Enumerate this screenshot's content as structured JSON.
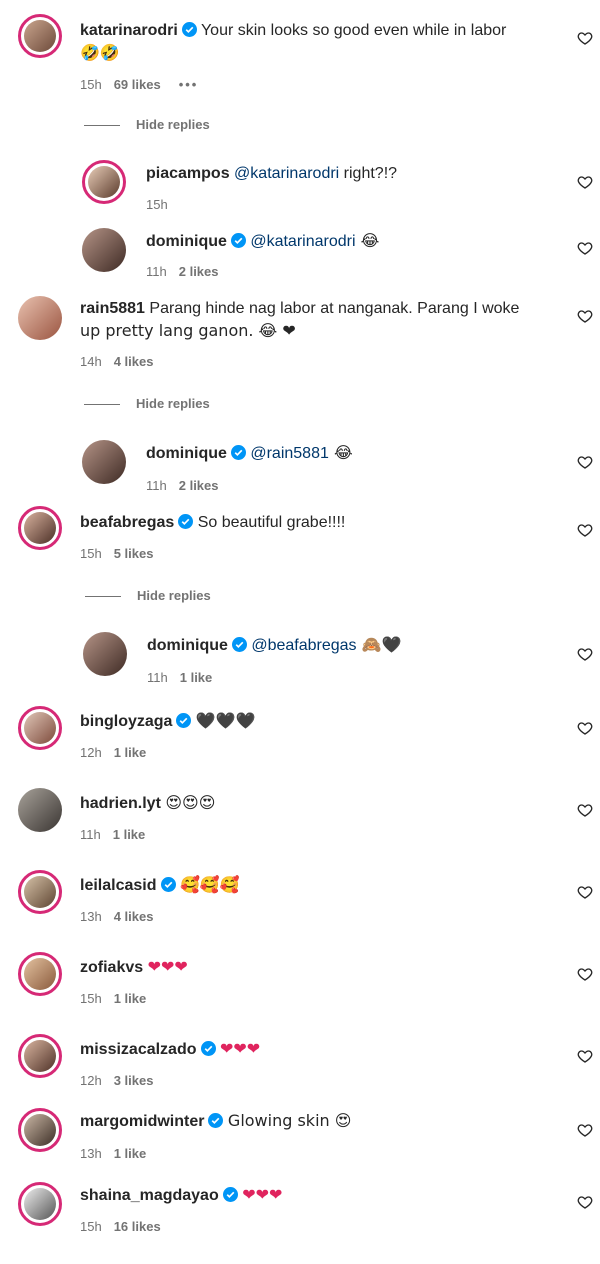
{
  "comments": [
    {
      "username": "katarinarodri",
      "verified": true,
      "text": "Your skin looks so good even while in labor",
      "text2": "🤣🤣",
      "time": "15h",
      "likes": "69 likes",
      "more": "•••"
    },
    {
      "username": "piacampos",
      "verified": false,
      "mention": "@katarinarodri",
      "text": " right?!?",
      "time": "15h",
      "likes": ""
    },
    {
      "username": "dominique",
      "verified": true,
      "mention": "@katarinarodri",
      "text": " 😂",
      "time": "11h",
      "likes": "2 likes"
    },
    {
      "username": "rain5881",
      "verified": false,
      "text": "Parang hinde nag labor at nanganak. Parang I woke",
      "text2": "up pretty lang ganon. 😂 ❤",
      "time": "14h",
      "likes": "4 likes"
    },
    {
      "username": "dominique",
      "verified": true,
      "mention": "@rain5881",
      "text": " 😂",
      "time": "11h",
      "likes": "2 likes"
    },
    {
      "username": "beafabregas",
      "verified": true,
      "text": "So beautiful grabe!!!!",
      "time": "15h",
      "likes": "5 likes"
    },
    {
      "username": "dominique",
      "verified": true,
      "mention": "@beafabregas",
      "text": " 🙈🖤",
      "time": "11h",
      "likes": "1 like"
    },
    {
      "username": "bingloyzaga",
      "verified": true,
      "text": "🖤🖤🖤",
      "time": "12h",
      "likes": "1 like"
    },
    {
      "username": "hadrien.lyt",
      "verified": false,
      "text": "😍😍😍",
      "time": "11h",
      "likes": "1 like"
    },
    {
      "username": "leilalcasid",
      "verified": true,
      "text": "🥰🥰🥰",
      "time": "13h",
      "likes": "4 likes"
    },
    {
      "username": "zofiakvs",
      "verified": false,
      "text": "❤❤❤",
      "time": "15h",
      "likes": "1 like"
    },
    {
      "username": "missizacalzado",
      "verified": true,
      "text": "❤❤❤",
      "time": "12h",
      "likes": "3 likes"
    },
    {
      "username": "margomidwinter",
      "verified": true,
      "text": "Glowing skin 😍",
      "time": "13h",
      "likes": "1 like"
    },
    {
      "username": "shaina_magdayao",
      "verified": true,
      "text": "❤❤❤",
      "time": "15h",
      "likes": "16 likes"
    }
  ],
  "hide_replies_label": "Hide replies",
  "colors": {
    "verified": "#0095f6",
    "mention": "#00376b",
    "meta": "#737373",
    "ring": "#d62976"
  },
  "icons": {
    "like": "heart-outline-icon",
    "verified": "verified-badge-icon"
  }
}
